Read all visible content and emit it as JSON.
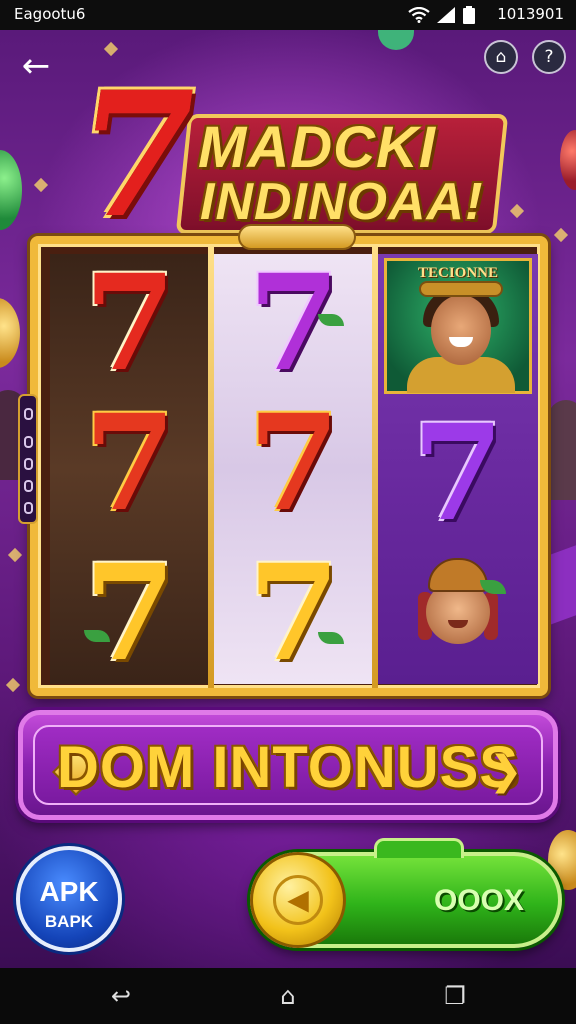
{
  "status_bar": {
    "left_text": "Eagootu6",
    "time": "1013901",
    "icons": [
      "wifi-icon",
      "signal-icon",
      "battery-icon"
    ]
  },
  "header": {
    "back_label": "←",
    "home_icon": "⌂",
    "help_icon": "?"
  },
  "logo": {
    "number": "7",
    "line1": "MADCKI",
    "line2": "INDINOAA!"
  },
  "reels": {
    "reel1": [
      {
        "symbol": "7",
        "color": "red"
      },
      {
        "symbol": "7",
        "color": "red-gold"
      },
      {
        "symbol": "7",
        "color": "gold"
      }
    ],
    "reel2": [
      {
        "symbol": "7",
        "color": "purple"
      },
      {
        "symbol": "7",
        "color": "red-gold"
      },
      {
        "symbol": "7",
        "color": "gold"
      }
    ],
    "reel3": [
      {
        "symbol": "portrait",
        "title": "TECIONNE"
      },
      {
        "symbol": "7",
        "color": "violet"
      },
      {
        "symbol": "head"
      }
    ]
  },
  "bonus": {
    "label": "DOM INTONUSS",
    "arrow": "❯"
  },
  "apk_badge": {
    "title": "APK",
    "subtitle": "BAPK"
  },
  "spin": {
    "coin_icon": "◀",
    "value": "OOOX"
  },
  "nav": {
    "back": "↩",
    "home": "⌂",
    "recent": "❐"
  },
  "colors": {
    "background": "#5a1a7a",
    "gold": "#f0b93a",
    "bonus_purple": "#8a22b0",
    "spin_green": "#2fb31a",
    "apk_blue": "#1444b8"
  }
}
